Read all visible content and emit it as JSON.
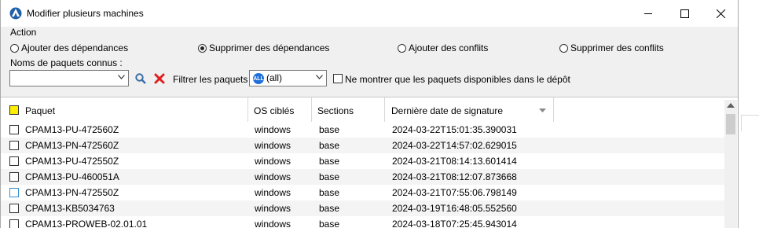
{
  "window": {
    "title": "Modifier plusieurs machines"
  },
  "action": {
    "label": "Action",
    "options": [
      {
        "label": "Ajouter des dépendances",
        "selected": false
      },
      {
        "label": "Supprimer des dépendances",
        "selected": true
      },
      {
        "label": "Ajouter des conflits",
        "selected": false
      },
      {
        "label": "Supprimer des conflits",
        "selected": false
      }
    ]
  },
  "known_packages": {
    "label": "Noms de paquets connus :",
    "value": ""
  },
  "filter": {
    "label": "Filtrer les paquets",
    "badge": "ALL",
    "value": "(all)",
    "only_available_label": "Ne montrer que les paquets disponibles dans le dépôt",
    "only_available_checked": false
  },
  "table": {
    "columns": [
      "Paquet",
      "OS ciblés",
      "Sections",
      "Dernière date de signature"
    ],
    "rows": [
      [
        "CPAM13-PU-472560Z",
        "windows",
        "base",
        "2024-03-22T15:01:35.390031"
      ],
      [
        "CPAM13-PN-472560Z",
        "windows",
        "base",
        "2024-03-22T14:57:02.629015"
      ],
      [
        "CPAM13-PU-472550Z",
        "windows",
        "base",
        "2024-03-21T08:14:13.601414"
      ],
      [
        "CPAM13-PU-460051A",
        "windows",
        "base",
        "2024-03-21T08:12:07.873668"
      ],
      [
        "CPAM13-PN-472550Z",
        "windows",
        "base",
        "2024-03-21T07:55:06.798149"
      ],
      [
        "CPAM13-KB5034763",
        "windows",
        "base",
        "2024-03-19T16:48:05.552560"
      ],
      [
        "CPAM13-PROWEB-02.01.01",
        "windows",
        "base",
        "2024-03-18T07:25:45.943014"
      ]
    ]
  },
  "colors": {
    "accent": "#1e6fd9",
    "clear": "#e02020",
    "header_check": "#ffee00"
  }
}
